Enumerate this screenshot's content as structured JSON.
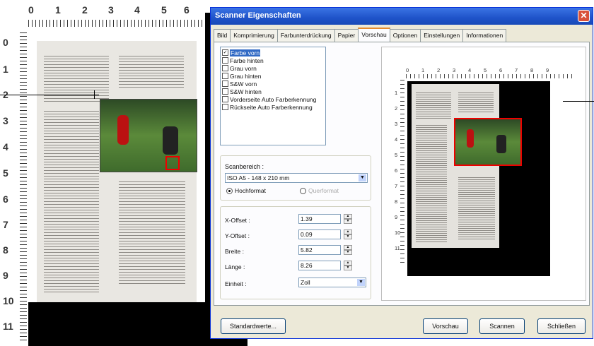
{
  "dialog": {
    "title": "Scanner Eigenschaften",
    "close_glyph": "✕",
    "tabs": [
      {
        "label": "Bild"
      },
      {
        "label": "Komprimierung"
      },
      {
        "label": "Farbunterdrückung"
      },
      {
        "label": "Papier"
      },
      {
        "label": "Vorschau",
        "active": true
      },
      {
        "label": "Optionen"
      },
      {
        "label": "Einstellungen"
      },
      {
        "label": "Informationen"
      }
    ],
    "image_list": [
      {
        "label": "Farbe vorn",
        "checked": true,
        "selected": true
      },
      {
        "label": "Farbe hinten",
        "checked": false
      },
      {
        "label": "Grau vorn",
        "checked": false
      },
      {
        "label": "Grau hinten",
        "checked": false
      },
      {
        "label": "S&W vorn",
        "checked": false
      },
      {
        "label": "S&W hinten",
        "checked": false
      },
      {
        "label": "Vorderseite Auto Farberkennung",
        "checked": false
      },
      {
        "label": "Rückseite Auto Farberkennung",
        "checked": false
      }
    ],
    "scan_area": {
      "label": "Scanbereich :",
      "selected": "ISO A5 - 148 x 210 mm",
      "orientation_portrait": "Hochformat",
      "orientation_landscape": "Querformat",
      "portrait_selected": true
    },
    "offsets": {
      "x_label": "X-Offset :",
      "x_value": "1.39",
      "y_label": "Y-Offset :",
      "y_value": "0.09",
      "width_label": "Breite :",
      "width_value": "5.82",
      "length_label": "Länge :",
      "length_value": "8.26",
      "unit_label": "Einheit :",
      "unit_value": "Zoll"
    },
    "buttons": {
      "defaults": "Standardwerte...",
      "preview": "Vorschau",
      "scan": "Scannen",
      "close": "Schließen"
    }
  },
  "preview_ruler": {
    "top": [
      "0",
      "1",
      "2",
      "3",
      "4",
      "5",
      "6",
      "7",
      "8",
      "9"
    ],
    "left": [
      "1",
      "2",
      "3",
      "4",
      "5",
      "6",
      "7",
      "8",
      "9",
      "10",
      "11"
    ]
  },
  "background_ruler": {
    "top": [
      "0",
      "1",
      "2",
      "3",
      "4",
      "5",
      "6"
    ],
    "left": [
      "0",
      "1",
      "2",
      "3",
      "4",
      "5",
      "6",
      "7",
      "8",
      "9",
      "10",
      "11"
    ]
  }
}
